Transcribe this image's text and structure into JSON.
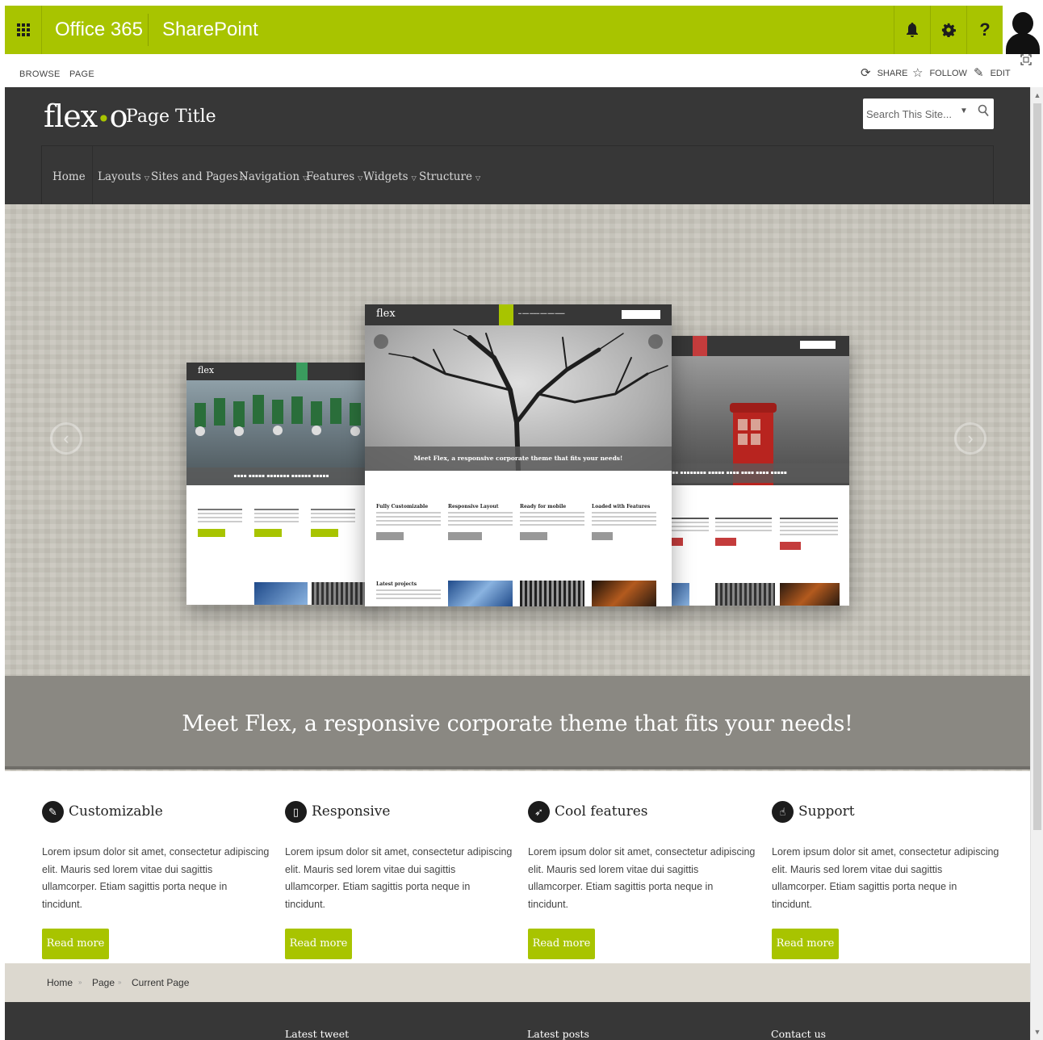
{
  "suite_bar": {
    "brand": "Office 365",
    "app": "SharePoint",
    "help_label": "?"
  },
  "ribbon": {
    "tabs": [
      "BROWSE",
      "PAGE"
    ],
    "actions": {
      "share": "SHARE",
      "follow": "FOLLOW",
      "edit": "EDIT"
    }
  },
  "site": {
    "logo_main": "flex",
    "logo_dot": "•",
    "logo_tail": "o",
    "page_title": "Page Title",
    "search_placeholder": "Search This Site..."
  },
  "nav": {
    "items": [
      {
        "label": "Home",
        "has_menu": false
      },
      {
        "label": "Layouts",
        "has_menu": true
      },
      {
        "label": "Sites and Pages",
        "has_menu": true
      },
      {
        "label": "Navigation",
        "has_menu": true
      },
      {
        "label": "Features",
        "has_menu": true
      },
      {
        "label": "Widgets",
        "has_menu": true
      },
      {
        "label": "Structure",
        "has_menu": true
      }
    ]
  },
  "hero": {
    "caption": "Meet Flex, a responsive corporate theme that fits your needs!",
    "mockup": {
      "logo": "flex",
      "caption": "Meet Flex, a responsive corporate theme that fits your needs!",
      "columns": [
        "Fully Customizable",
        "Responsive Layout",
        "Ready for mobile",
        "Loaded with Features"
      ],
      "latest": "Latest projects"
    }
  },
  "features": [
    {
      "icon": "wand-icon",
      "glyph": "✎",
      "title": "Customizable",
      "text": "Lorem ipsum dolor sit amet, consectetur adipiscing elit. Mauris sed lorem vitae dui sagittis ullamcorper. Etiam sagittis porta neque in tincidunt.",
      "button": "Read more"
    },
    {
      "icon": "mobile-icon",
      "glyph": "▯",
      "title": "Responsive",
      "text": "Lorem ipsum dolor sit amet, consectetur adipiscing elit. Mauris sed lorem vitae dui sagittis ullamcorper. Etiam sagittis porta neque in tincidunt.",
      "button": "Read more"
    },
    {
      "icon": "rocket-icon",
      "glyph": "➶",
      "title": "Cool features",
      "text": "Lorem ipsum dolor sit amet, consectetur adipiscing elit. Mauris sed lorem vitae dui sagittis ullamcorper. Etiam sagittis porta neque in tincidunt.",
      "button": "Read more"
    },
    {
      "icon": "thumbs-up-icon",
      "glyph": "☝",
      "title": "Support",
      "text": "Lorem ipsum dolor sit amet, consectetur adipiscing elit. Mauris sed lorem vitae dui sagittis ullamcorper. Etiam sagittis porta neque in tincidunt.",
      "button": "Read more"
    }
  ],
  "breadcrumb": [
    "Home",
    "Page",
    "Current Page"
  ],
  "breadcrumb_separator": "»",
  "footer": {
    "headings": [
      "Latest tweet",
      "Latest posts",
      "Contact us"
    ]
  },
  "colors": {
    "accent": "#a8c400",
    "header_bg": "#373737",
    "breadcrumb_bg": "#dcd8cf"
  }
}
